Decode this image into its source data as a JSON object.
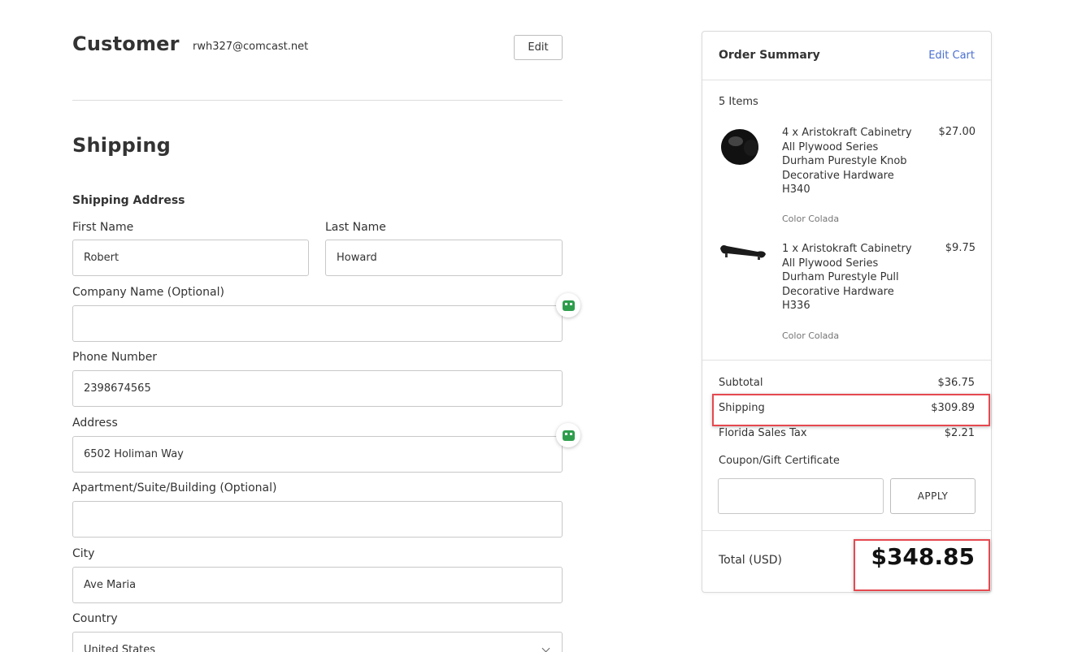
{
  "customer": {
    "title": "Customer",
    "email": "rwh327@comcast.net",
    "edit_label": "Edit"
  },
  "shipping": {
    "title": "Shipping",
    "section_label": "Shipping Address",
    "fields": {
      "first_name": {
        "label": "First Name",
        "value": "Robert"
      },
      "last_name": {
        "label": "Last Name",
        "value": "Howard"
      },
      "company": {
        "label": "Company Name (Optional)",
        "value": ""
      },
      "phone": {
        "label": "Phone Number",
        "value": "2398674565"
      },
      "address": {
        "label": "Address",
        "value": "6502 Holiman Way"
      },
      "apartment": {
        "label": "Apartment/Suite/Building (Optional)",
        "value": ""
      },
      "city": {
        "label": "City",
        "value": "Ave Maria"
      },
      "country": {
        "label": "Country",
        "value": "United States"
      }
    }
  },
  "order_summary": {
    "title": "Order Summary",
    "edit_cart_label": "Edit Cart",
    "items_count": "5 Items",
    "items": [
      {
        "name": "4 x Aristokraft Cabinetry All Plywood Series Durham Purestyle Knob Decorative Hardware H340",
        "price": "$27.00",
        "option": "Color Colada",
        "icon": "knob-icon"
      },
      {
        "name": "1 x Aristokraft Cabinetry All Plywood Series Durham Purestyle Pull Decorative Hardware H336",
        "price": "$9.75",
        "option": "Color Colada",
        "icon": "pull-handle-icon"
      }
    ],
    "subtotal": {
      "label": "Subtotal",
      "value": "$36.75"
    },
    "shipping": {
      "label": "Shipping",
      "value": "$309.89"
    },
    "tax": {
      "label": "Florida Sales Tax",
      "value": "$2.21"
    },
    "coupon": {
      "label": "Coupon/Gift Certificate",
      "value": "",
      "apply_label": "APPLY"
    },
    "total": {
      "label": "Total (USD)",
      "value": "$348.85"
    }
  },
  "colors": {
    "accent_link": "#4a6fd3",
    "highlight": "#e5494f",
    "autofill_icon": "#2e9e4d"
  }
}
